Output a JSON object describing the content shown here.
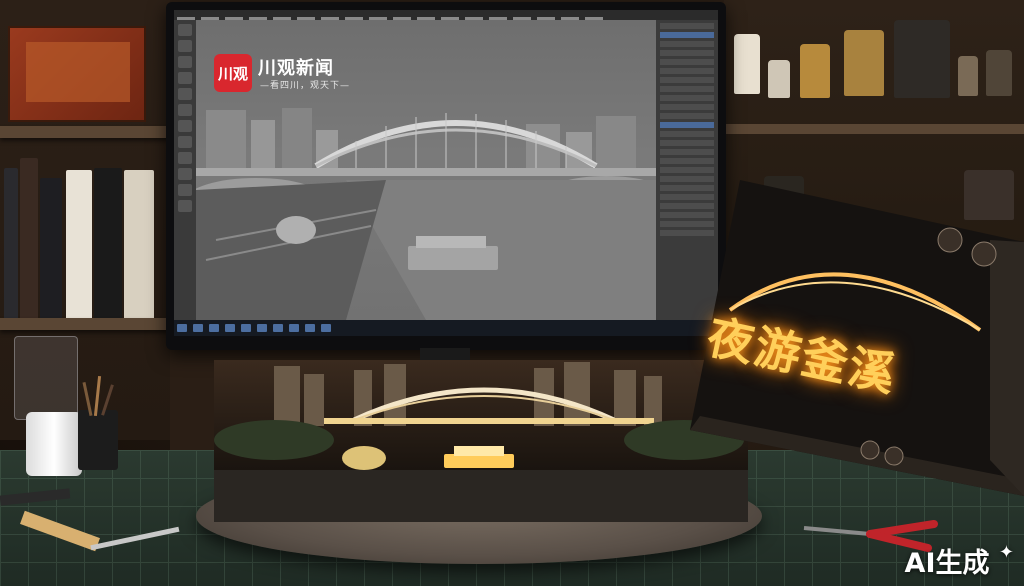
{
  "screen_overlay": {
    "logo_badge": "川观",
    "logo_title": "川观新闻",
    "logo_slogan": "—看四川，观天下—"
  },
  "game_box": {
    "title": "夜游釜溪"
  },
  "watermark": {
    "text": "AI生成"
  },
  "colors": {
    "logo_red": "#d9272e",
    "box_glow": "#ffb030",
    "bridge_light": "#f4e6c8",
    "desk_mat": "#2b3a30"
  },
  "icons": [
    "sparkle-icon"
  ]
}
